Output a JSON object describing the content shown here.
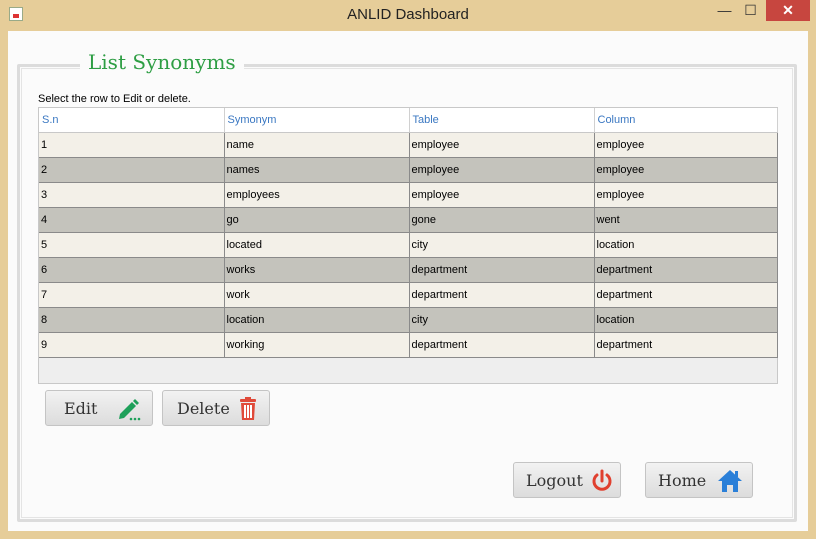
{
  "window": {
    "title": "ANLID Dashboard",
    "minimize": "—",
    "maximize": "☐",
    "close": "✕"
  },
  "panel": {
    "legend": "List Synonyms",
    "hint": "Select the row to Edit or delete."
  },
  "table": {
    "headers": [
      "S.n",
      "Symonym",
      "Table",
      "Column"
    ],
    "rows": [
      [
        "1",
        "name",
        "employee",
        "employee"
      ],
      [
        "2",
        "names",
        "employee",
        "employee"
      ],
      [
        "3",
        "employees",
        "employee",
        "employee"
      ],
      [
        "4",
        "go",
        "gone",
        "went"
      ],
      [
        "5",
        "located",
        "city",
        "location"
      ],
      [
        "6",
        "works",
        "department",
        "department"
      ],
      [
        "7",
        "work",
        "department",
        "department"
      ],
      [
        "8",
        "location",
        "city",
        "location"
      ],
      [
        "9",
        "working",
        "department",
        "department"
      ]
    ]
  },
  "buttons": {
    "edit": "Edit",
    "delete": "Delete",
    "logout": "Logout",
    "home": "Home"
  },
  "icons": {
    "edit": "pencil-icon",
    "delete": "trash-icon",
    "logout": "power-icon",
    "home": "house-icon"
  },
  "colors": {
    "legend": "#2e9e44",
    "header_text": "#3b78c2",
    "edit_icon": "#1ea05a",
    "delete_icon": "#e04a3a",
    "logout_icon": "#e0402f",
    "home_icon": "#2a7fd8",
    "close_button": "#c7463f"
  }
}
